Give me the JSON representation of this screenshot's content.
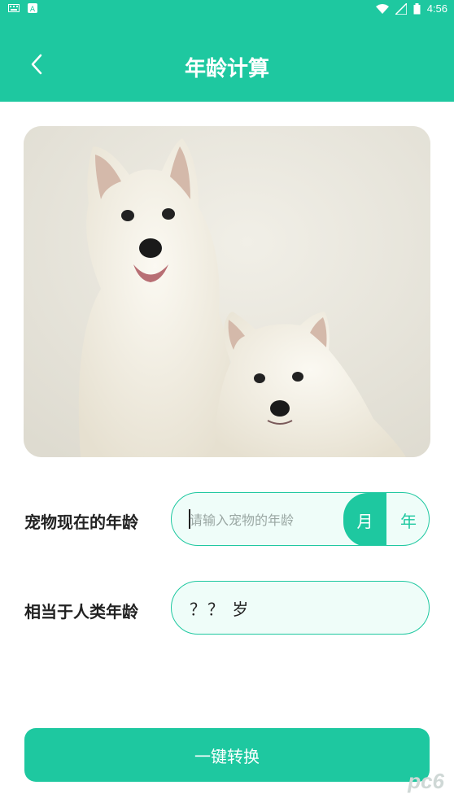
{
  "status_bar": {
    "time": "4:56",
    "icons": [
      "keyboard-icon",
      "app-icon",
      "wifi-icon",
      "signal-icon",
      "battery-icon"
    ]
  },
  "header": {
    "title": "年龄计算",
    "back_icon": "chevron-left-icon",
    "color": "#1ec8a0"
  },
  "hero_image": {
    "subject": "two white dogs"
  },
  "form": {
    "pet_age_label": "宠物现在的年龄",
    "pet_age_placeholder": "请输入宠物的年龄",
    "unit_month": "月",
    "unit_year": "年",
    "selected_unit": "月",
    "human_age_label": "相当于人类年龄",
    "human_age_value": "？？ 岁"
  },
  "action": {
    "convert_label": "一键转换"
  },
  "watermark": "pc6"
}
